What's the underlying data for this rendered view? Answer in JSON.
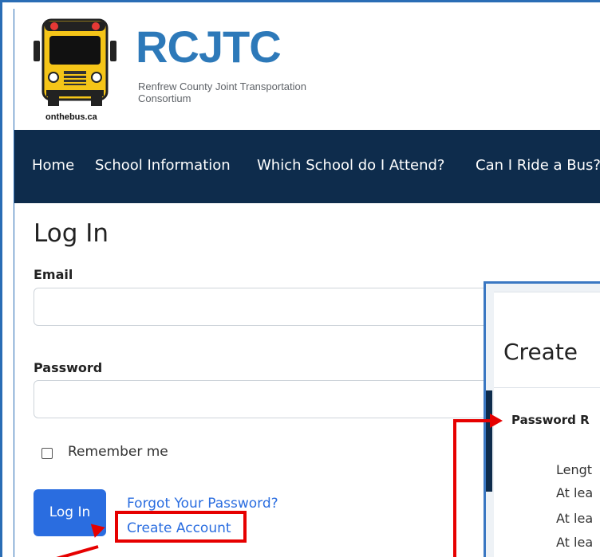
{
  "brand": {
    "acronym": "RCJTC",
    "subtitle": "Renfrew County Joint Transportation Consortium",
    "tagline": "onthebus.ca"
  },
  "nav": {
    "items": [
      "Home",
      "School Information",
      "Which School do I Attend?",
      "Can I Ride a Bus?"
    ]
  },
  "login": {
    "title": "Log In",
    "email_label": "Email",
    "email_value": "",
    "password_label": "Password",
    "password_value": "",
    "remember_label": "Remember me",
    "remember_checked": false,
    "submit_label": "Log In",
    "forgot_label": "Forgot Your Password?",
    "create_label": "Create Account"
  },
  "modal": {
    "title": "Create",
    "heading": "Password R",
    "requirements": [
      "Lengt",
      "At lea",
      "At lea",
      "At lea"
    ]
  },
  "colors": {
    "nav_bg": "#0e2c4c",
    "brand_blue": "#2d79b9",
    "button_blue": "#2a6de0",
    "annotation_red": "#e60000"
  }
}
